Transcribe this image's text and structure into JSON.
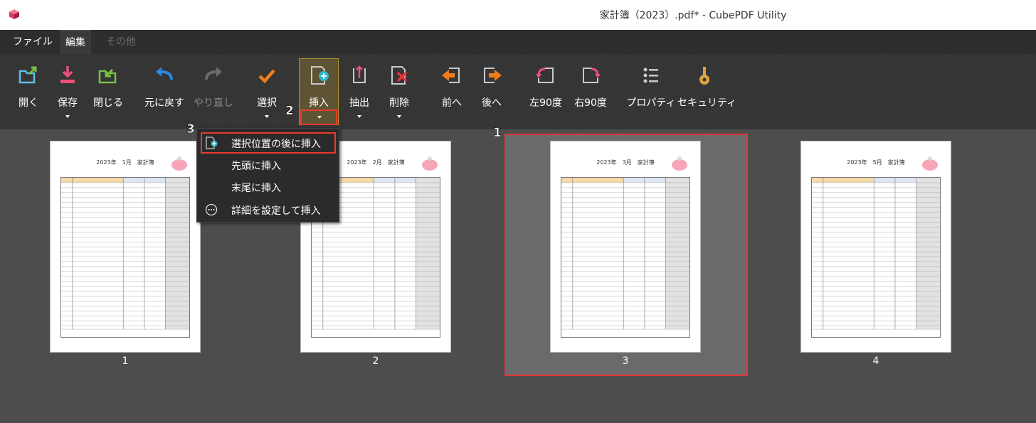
{
  "window": {
    "title": "家計簿（2023）.pdf* - CubePDF Utility"
  },
  "menu_tabs": [
    "ファイル",
    "編集",
    "その他"
  ],
  "ribbon": {
    "open": "開く",
    "save": "保存",
    "close": "閉じる",
    "undo": "元に戻す",
    "redo": "やり直し",
    "select": "選択",
    "insert": "挿入",
    "extract": "抽出",
    "delete": "削除",
    "previous": "前へ",
    "next": "後へ",
    "rotate_left": "左90度",
    "rotate_right": "右90度",
    "properties": "プロパティ",
    "security": "セキュリティ"
  },
  "insert_menu": {
    "after_selection": "選択位置の後に挿入",
    "at_beginning": "先頭に挿入",
    "at_end": "末尾に挿入",
    "detailed": "詳細を設定して挿入"
  },
  "pages": [
    {
      "number": "1",
      "header": "2023年　1月　家計簿",
      "selected": false
    },
    {
      "number": "2",
      "header": "2023年　2月　家計簿",
      "selected": false
    },
    {
      "number": "3",
      "header": "2023年　3月　家計簿",
      "selected": true
    },
    {
      "number": "4",
      "header": "2023年　5月　家計簿",
      "selected": false
    }
  ],
  "annotations": [
    "1",
    "2",
    "3"
  ],
  "colors": {
    "accent_red": "#e83a2c",
    "insert_highlight": "#5e5433",
    "canvas": "#4d4d4d",
    "ribbon": "#333333"
  }
}
